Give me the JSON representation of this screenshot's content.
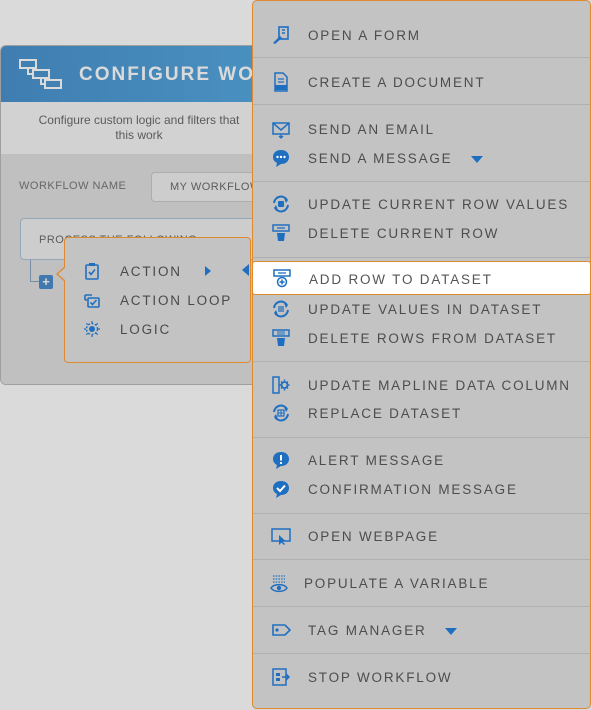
{
  "dialog": {
    "title": "CONFIGURE WO",
    "subtitle_line1": "Configure custom logic and filters that",
    "subtitle_line2": "this work",
    "workflow_name_label": "WORKFLOW NAME",
    "workflow_name_value": "MY WORKFLOW",
    "process_label": "PROCESS THE FOLLOWING",
    "add_label": "+"
  },
  "submenu": {
    "items": [
      {
        "label": "ACTION",
        "icon": "clipboard-check-icon"
      },
      {
        "label": "ACTION LOOP",
        "icon": "loop-check-icon"
      },
      {
        "label": "LOGIC",
        "icon": "logic-gear-icon"
      }
    ]
  },
  "menu": {
    "items": [
      {
        "label": "OPEN A FORM",
        "icon": "form-pen-icon"
      },
      {
        "label": "CREATE A DOCUMENT",
        "icon": "pdf-document-icon"
      },
      {
        "label": "SEND AN EMAIL",
        "icon": "envelope-icon"
      },
      {
        "label": "SEND A MESSAGE",
        "icon": "chat-bubble-icon"
      },
      {
        "label": "UPDATE CURRENT ROW VALUES",
        "icon": "sync-database-icon"
      },
      {
        "label": "DELETE CURRENT ROW",
        "icon": "trash-row-icon"
      },
      {
        "label": "ADD ROW TO DATASET",
        "icon": "add-row-icon"
      },
      {
        "label": "UPDATE VALUES IN DATASET",
        "icon": "sync-values-icon"
      },
      {
        "label": "DELETE ROWS FROM DATASET",
        "icon": "trash-rows-icon"
      },
      {
        "label": "UPDATE MAPLINE DATA COLUMN",
        "icon": "column-gear-icon"
      },
      {
        "label": "REPLACE DATASET",
        "icon": "replace-dataset-icon"
      },
      {
        "label": "ALERT MESSAGE",
        "icon": "alert-bubble-icon"
      },
      {
        "label": "CONFIRMATION MESSAGE",
        "icon": "check-bubble-icon"
      },
      {
        "label": "OPEN WEBPAGE",
        "icon": "monitor-cursor-icon"
      },
      {
        "label": "POPULATE A VARIABLE",
        "icon": "eye-list-icon"
      },
      {
        "label": "TAG MANAGER",
        "icon": "tag-icon"
      },
      {
        "label": "STOP WORKFLOW",
        "icon": "stop-workflow-icon"
      }
    ]
  },
  "colors": {
    "accent": "#1f6fc1",
    "highlight_border": "#e08a2f",
    "header_blue": "#1b77c2"
  }
}
